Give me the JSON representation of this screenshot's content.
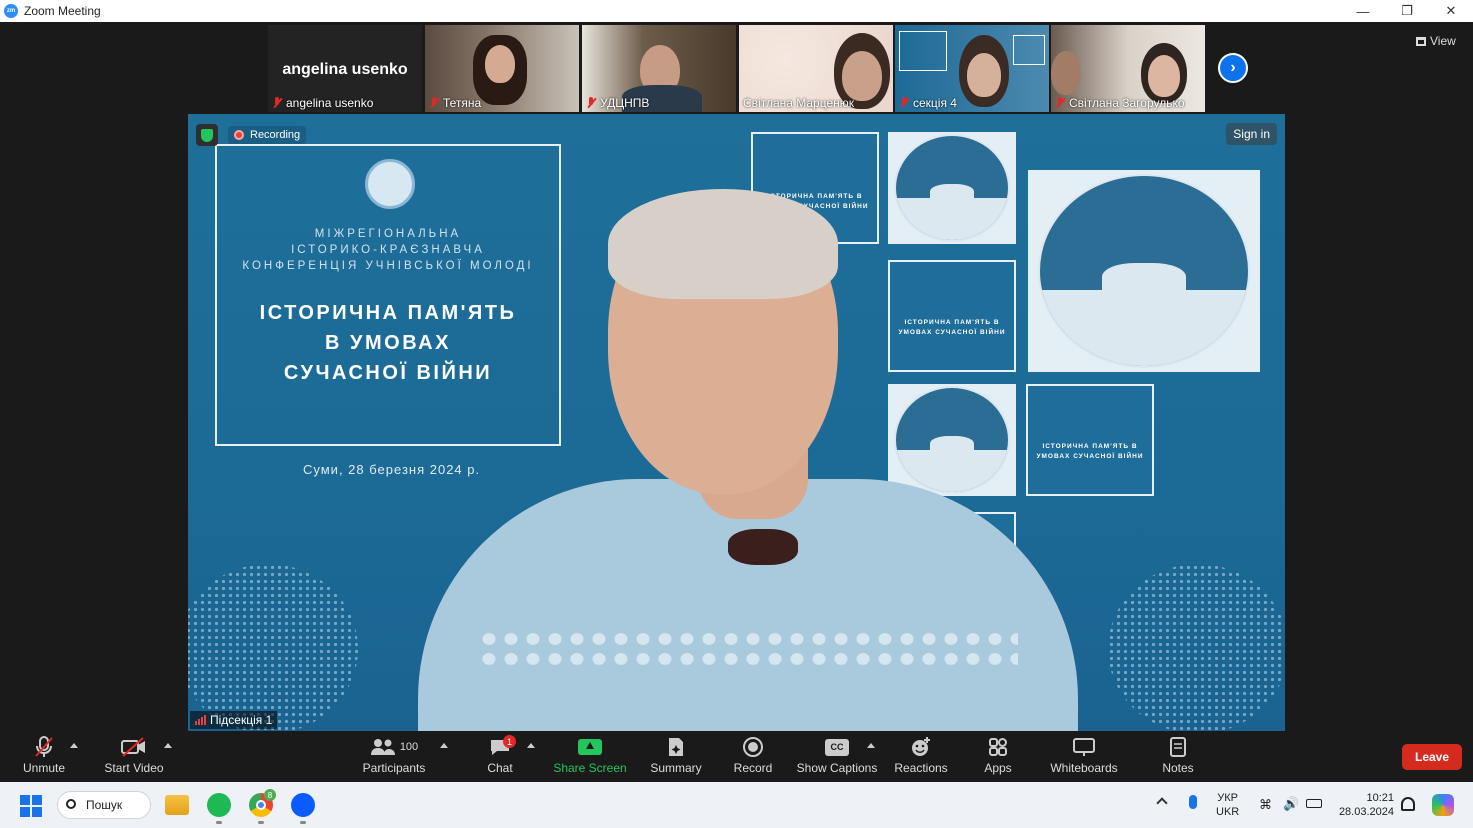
{
  "window": {
    "title": "Zoom Meeting",
    "app_icon": "zoom-app-icon"
  },
  "gallery": {
    "participants": [
      {
        "name": "angelina usenko",
        "display_name": "angelina usenko",
        "muted": true,
        "video": false
      },
      {
        "name": "Тетяна",
        "muted": true,
        "video": true
      },
      {
        "name": "УДЦНПВ",
        "muted": true,
        "video": true
      },
      {
        "name": "Світлана Марценюк",
        "muted": false,
        "video": true
      },
      {
        "name": "секція 4",
        "muted": true,
        "video": true
      },
      {
        "name": "Світлана Загорулько",
        "muted": true,
        "video": true
      }
    ],
    "view_label": "View"
  },
  "stage": {
    "recording_label": "Recording",
    "signin_label": "Sign in",
    "subsession_label": "Підсекція 1",
    "poster": {
      "conference_lines": [
        "МІЖРЕГІОНАЛЬНА",
        "ІСТОРИКО-КРАЄЗНАВЧА",
        "КОНФЕРЕНЦІЯ УЧНІВСЬКОЇ МОЛОДІ"
      ],
      "headline_lines": [
        "ІСТОРИЧНА ПАМ'ЯТЬ",
        "В УМОВАХ",
        "СУЧАСНОЇ ВІЙНИ"
      ],
      "city_date": "Суми, 28 березня 2024 р."
    },
    "mini_title": "ІСТОРИЧНА ПАМ'ЯТЬ В УМОВАХ СУЧАСНОЇ ВІЙНИ"
  },
  "toolbar": {
    "unmute": "Unmute",
    "start_video": "Start Video",
    "participants": "Participants",
    "participants_count": "100",
    "chat": "Chat",
    "chat_badge": "1",
    "share_screen": "Share Screen",
    "summary": "Summary",
    "record": "Record",
    "show_captions": "Show Captions",
    "cc": "CC",
    "reactions": "Reactions",
    "apps": "Apps",
    "whiteboards": "Whiteboards",
    "notes": "Notes",
    "leave": "Leave"
  },
  "taskbar": {
    "search_label": "Пошук",
    "lang_top": "УКР",
    "lang_bottom": "UKR",
    "time": "10:21",
    "date": "28.03.2024",
    "chrome_badge": "8"
  },
  "colors": {
    "accent_blue": "#0e72ed",
    "leave_red": "#d52b1e",
    "share_green": "#22c55e",
    "stage_blue": "#1f6f9b"
  }
}
